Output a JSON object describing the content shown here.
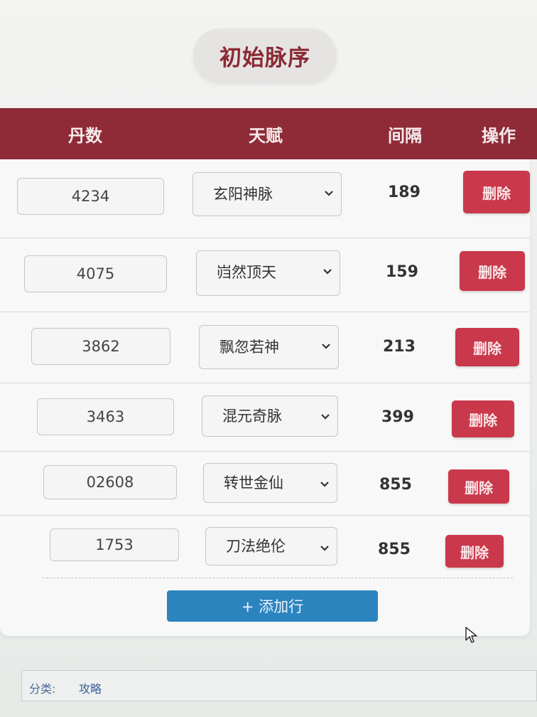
{
  "page": {
    "title": "初始脉序"
  },
  "table": {
    "headers": {
      "pill_count": "丹数",
      "talent": "天赋",
      "interval": "间隔",
      "action": "操作"
    },
    "rows": [
      {
        "pill_count": "4234",
        "talent": "玄阳神脉",
        "interval": "189",
        "delete_label": "删除"
      },
      {
        "pill_count": "4075",
        "talent": "岿然顶天",
        "interval": "159",
        "delete_label": "删除"
      },
      {
        "pill_count": "3862",
        "talent": "飘忽若神",
        "interval": "213",
        "delete_label": "删除"
      },
      {
        "pill_count": "3463",
        "talent": "混元奇脉",
        "interval": "399",
        "delete_label": "删除"
      },
      {
        "pill_count": "02608",
        "talent": "转世金仙",
        "interval": "855",
        "delete_label": "删除"
      },
      {
        "pill_count": "1753",
        "talent": "刀法绝伦",
        "interval": "855",
        "delete_label": "删除"
      }
    ],
    "add_row_label": "+ 添加行"
  },
  "footer": {
    "category_label": "分类:",
    "category_value": "攻略"
  },
  "colors": {
    "header_bg": "#8e2b37",
    "delete_button": "#c9384b",
    "add_button": "#2c84bf"
  },
  "icons": {
    "select_arrow": "chevron-down-icon",
    "cursor": "mouse-pointer-icon"
  }
}
